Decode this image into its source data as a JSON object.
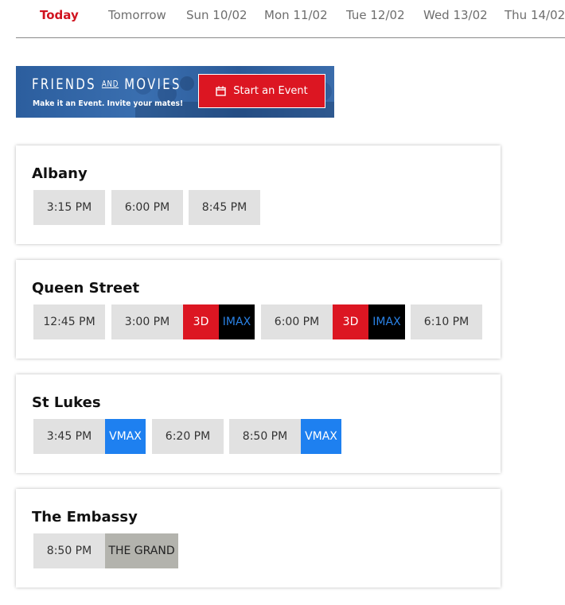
{
  "date_tabs": [
    {
      "label": "Today",
      "active": true
    },
    {
      "label": "Tomorrow",
      "active": false
    },
    {
      "label": "Sun 10/02",
      "active": false
    },
    {
      "label": "Mon 11/02",
      "active": false
    },
    {
      "label": "Tue 12/02",
      "active": false
    },
    {
      "label": "Wed 13/02",
      "active": false
    },
    {
      "label": "Thu 14/02",
      "active": false
    }
  ],
  "banner": {
    "title_left": "FRIENDS",
    "title_and": "AND",
    "title_right": "MOVIES",
    "subtitle": "Make it an Event. Invite your mates!",
    "button_label": "Start an Event",
    "button_icon": "calendar-icon"
  },
  "colors": {
    "accent_red": "#d0131f",
    "banner_blue": "#2c5e9e",
    "tag_3d": "#dc1622",
    "tag_imax_bg": "#000000",
    "tag_imax_text": "#2a82e6",
    "tag_vmax": "#1e80f0",
    "tag_grand": "#b3b3ad",
    "time_button": "#e1e1e1"
  },
  "cinemas": [
    {
      "name": "Albany",
      "sessions": [
        {
          "time": "3:15 PM",
          "tags": []
        },
        {
          "time": "6:00 PM",
          "tags": []
        },
        {
          "time": "8:45 PM",
          "tags": []
        }
      ]
    },
    {
      "name": "Queen Street",
      "sessions": [
        {
          "time": "12:45 PM",
          "tags": []
        },
        {
          "time": "3:00 PM",
          "tags": [
            "3D",
            "IMAX"
          ]
        },
        {
          "time": "6:00 PM",
          "tags": [
            "3D",
            "IMAX"
          ]
        },
        {
          "time": "6:10 PM",
          "tags": []
        }
      ]
    },
    {
      "name": "St Lukes",
      "sessions": [
        {
          "time": "3:45 PM",
          "tags": [
            "VMAX"
          ]
        },
        {
          "time": "6:20 PM",
          "tags": []
        },
        {
          "time": "8:50 PM",
          "tags": [
            "VMAX"
          ]
        }
      ]
    },
    {
      "name": "The Embassy",
      "sessions": [
        {
          "time": "8:50 PM",
          "tags": [
            "THE GRAND"
          ]
        }
      ]
    }
  ]
}
